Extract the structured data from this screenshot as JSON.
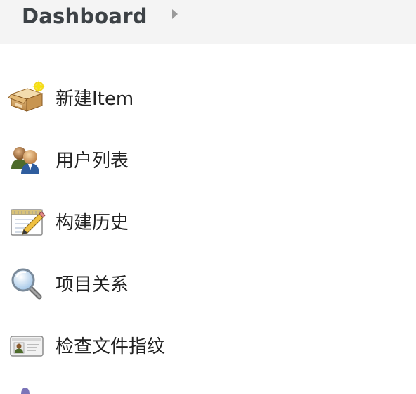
{
  "breadcrumb": {
    "root_label": "Dashboard"
  },
  "tasks": [
    {
      "label": "新建Item",
      "icon": "new-package-icon"
    },
    {
      "label": "用户列表",
      "icon": "users-icon"
    },
    {
      "label": "构建历史",
      "icon": "notepad-pencil-icon"
    },
    {
      "label": "项目关系",
      "icon": "magnifier-icon"
    },
    {
      "label": "检查文件指纹",
      "icon": "id-card-icon"
    }
  ]
}
